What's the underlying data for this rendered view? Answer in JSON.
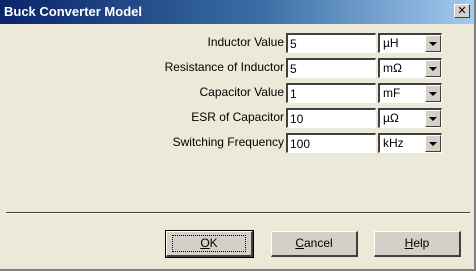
{
  "window": {
    "title": "Buck Converter Model",
    "close_glyph": "✕"
  },
  "fields": [
    {
      "label": "Inductor Value",
      "value": "5",
      "unit": "µH"
    },
    {
      "label": "Resistance of Inductor",
      "value": "5",
      "unit": "mΩ"
    },
    {
      "label": "Capacitor Value",
      "value": "1",
      "unit": "mF"
    },
    {
      "label": "ESR of Capacitor",
      "value": "10",
      "unit": "µΩ"
    },
    {
      "label": "Switching Frequency",
      "value": "100",
      "unit": "kHz"
    }
  ],
  "buttons": {
    "ok": {
      "accel": "O",
      "rest": "K"
    },
    "cancel": {
      "accel": "C",
      "rest": "ancel"
    },
    "help": {
      "accel": "H",
      "rest": "elp"
    }
  },
  "icons": {
    "close": "close-icon",
    "dropdown": "chevron-down-icon"
  }
}
